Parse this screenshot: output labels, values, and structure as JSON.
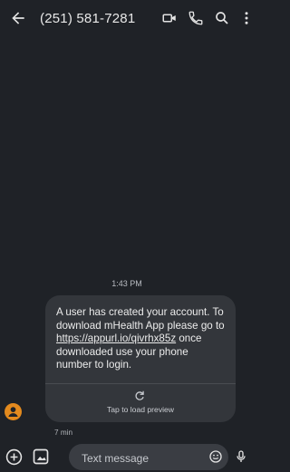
{
  "header": {
    "title": "(251) 581-7281",
    "icons": [
      "back-arrow-icon",
      "video-call-icon",
      "phone-icon",
      "search-icon",
      "more-vert-icon"
    ]
  },
  "conversation": {
    "timestamp": "1:43 PM",
    "message": {
      "text_before": "A user has created your account. To download mHealth App please go to ",
      "link": "https://appurl.io/qivrhx85z",
      "text_after": " once downloaded use your phone number to login.",
      "preview_label": "Tap to load preview",
      "time": "7 min"
    }
  },
  "composer": {
    "placeholder": "Text message"
  },
  "colors": {
    "background": "#1f2227",
    "bubble": "#33363b",
    "avatar": "#e38a1e",
    "input": "#3a3d43"
  }
}
